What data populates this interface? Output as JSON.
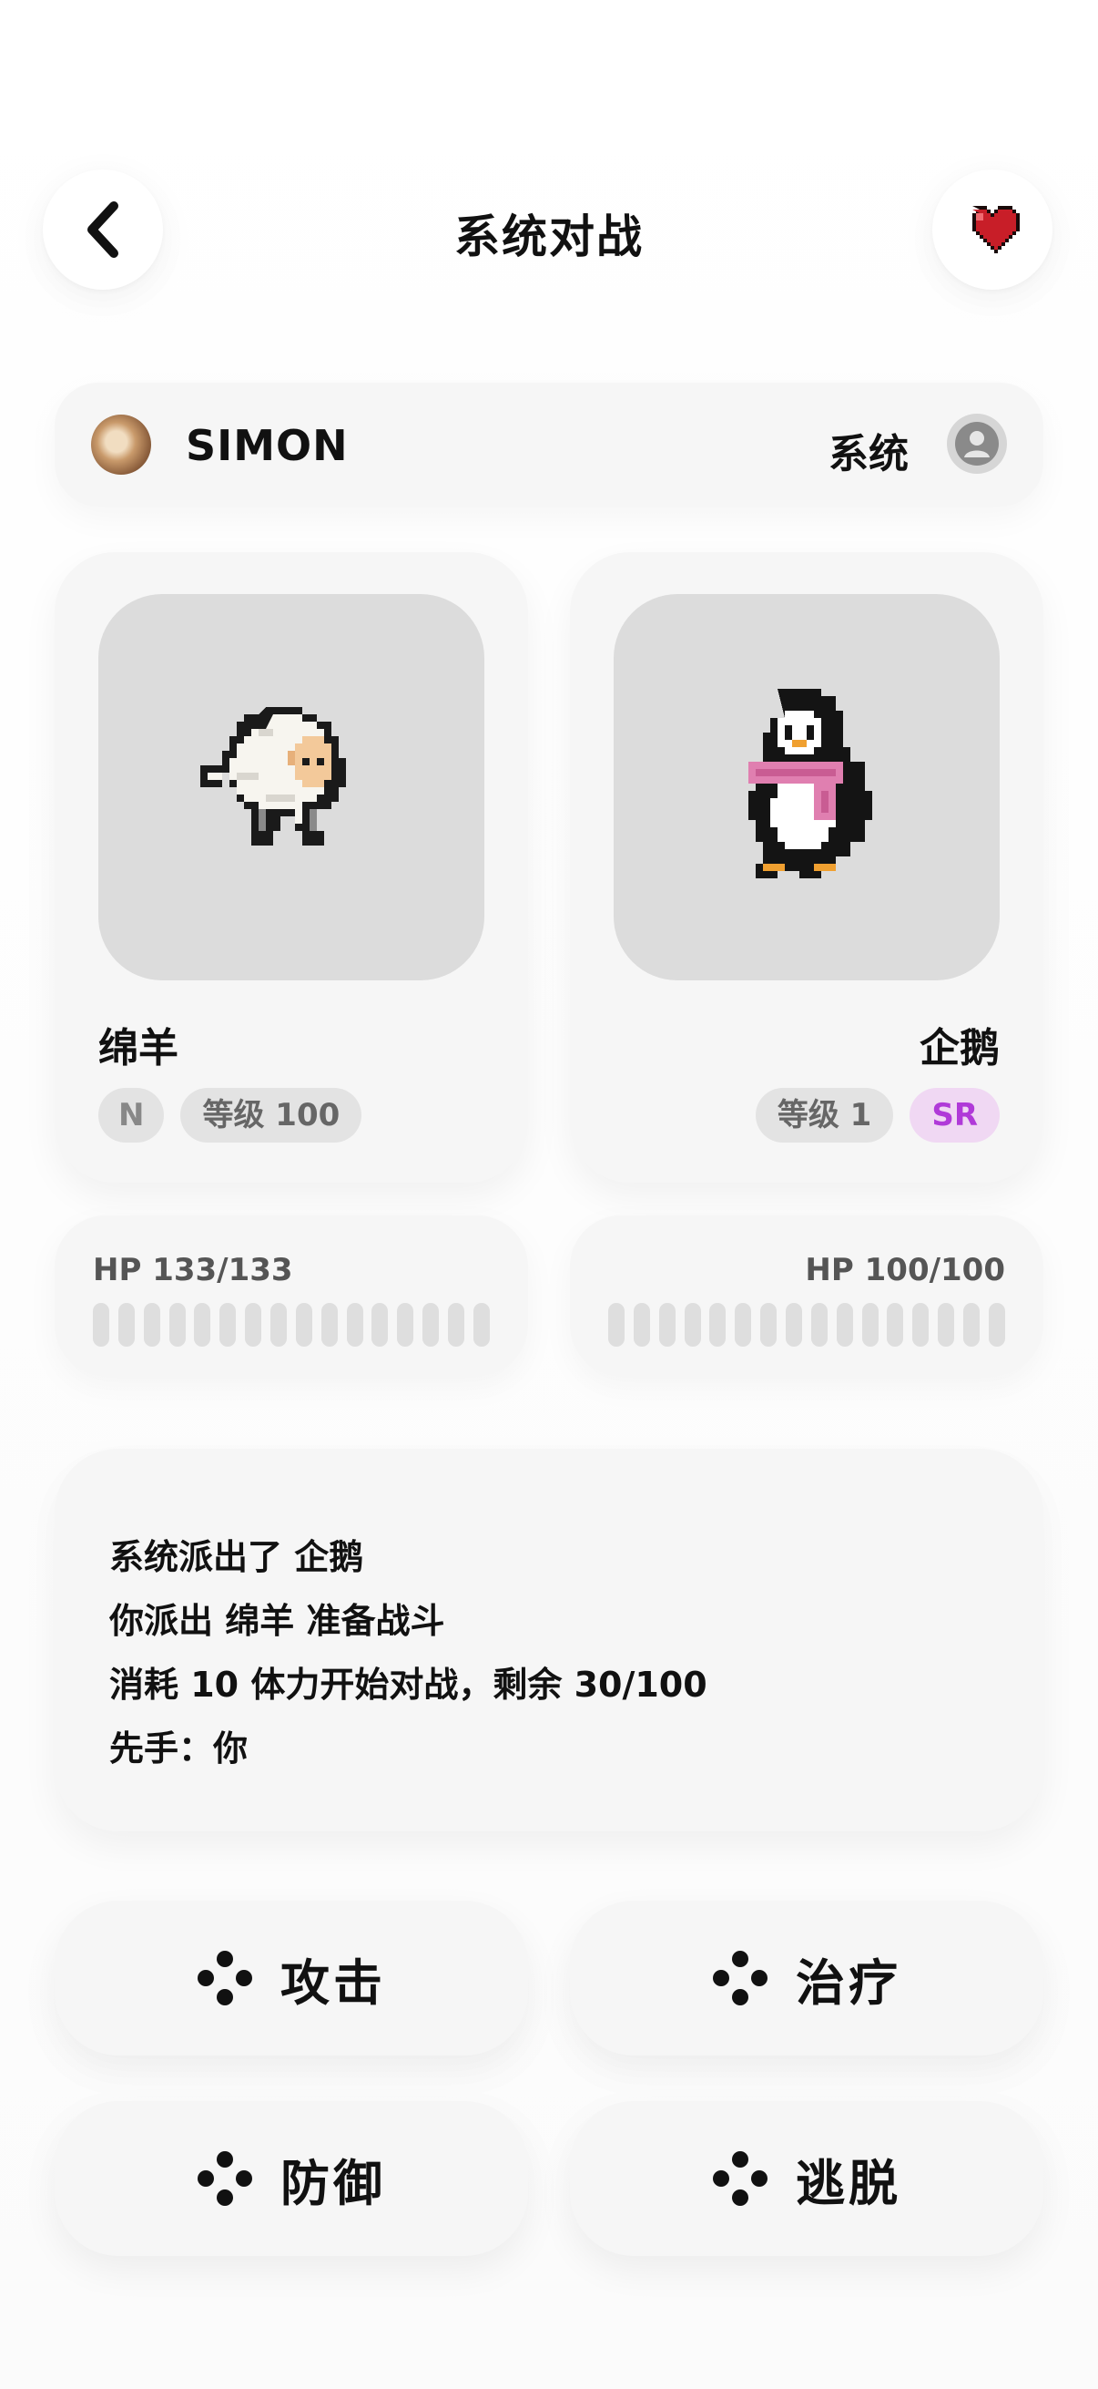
{
  "header": {
    "title": "系统对战",
    "back_icon": "chevron-left-icon",
    "favorite_icon": "pixel-heart-icon",
    "heart_color": "#c81e28"
  },
  "players": {
    "player_name": "SIMON",
    "opponent_name": "系统"
  },
  "pets": {
    "left": {
      "name": "绵羊",
      "rarity": "N",
      "level": "等级 100",
      "sprite": "pixel-sheep-icon",
      "hp_label": "HP 133/133",
      "hp_current": 133,
      "hp_max": 133
    },
    "right": {
      "name": "企鹅",
      "rarity": "SR",
      "level": "等级 1",
      "sprite": "pixel-penguin-icon",
      "hp_label": "HP 100/100",
      "hp_current": 100,
      "hp_max": 100
    }
  },
  "battle_log": [
    "系统派出了 企鹅",
    "你派出 绵羊 准备战斗",
    "消耗 10 体力开始对战，剩余 30/100",
    "先手：你"
  ],
  "actions": {
    "attack": "攻击",
    "heal": "治疗",
    "defend": "防御",
    "escape": "逃脱",
    "icon": "gamepad-dots-icon"
  },
  "colors": {
    "card_bg": "#f6f6f6",
    "sprite_bg": "#dcdcdc",
    "sr_badge_text": "#b03ad8",
    "sr_badge_bg": "#f0d8f3"
  }
}
